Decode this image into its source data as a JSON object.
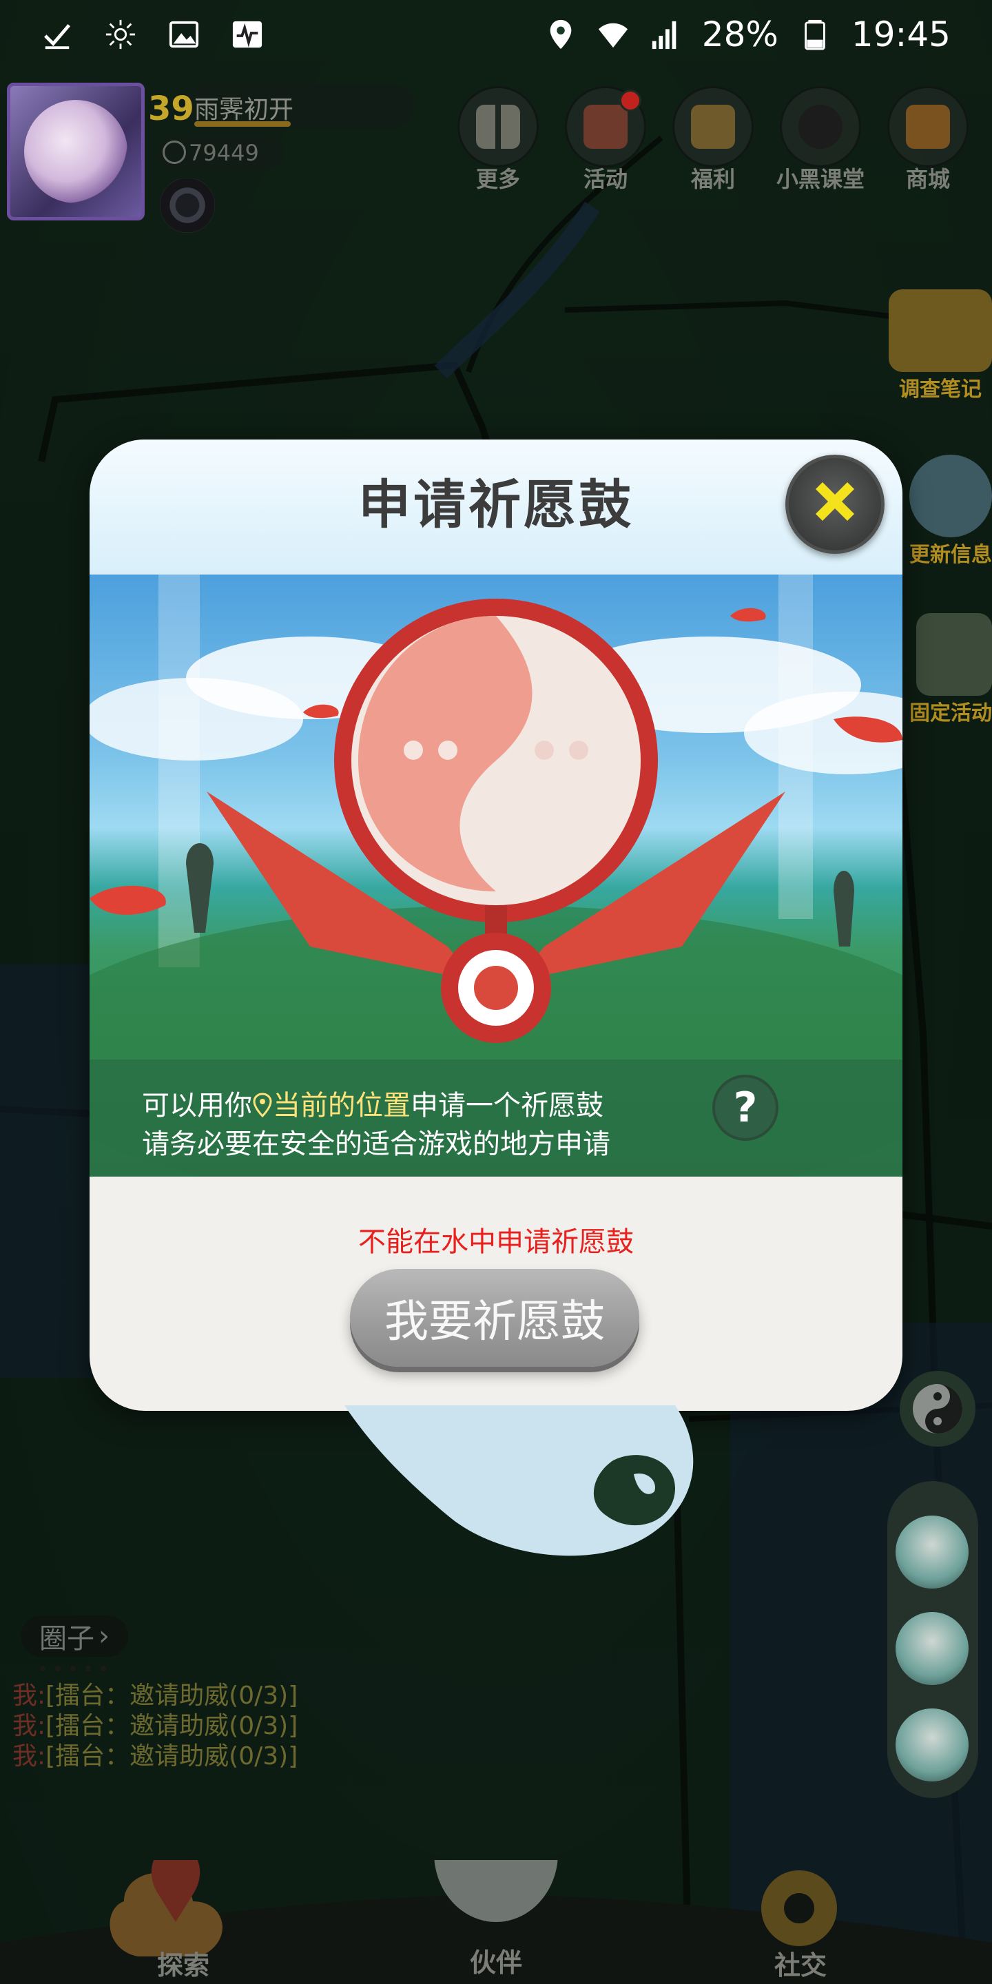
{
  "status_bar": {
    "battery": "28%",
    "time": "19:45"
  },
  "hud": {
    "level": "39",
    "player_name": "雨霁初开",
    "coins": "79449"
  },
  "top_menu": [
    {
      "label": "更多",
      "icon": "grid-icon"
    },
    {
      "label": "活动",
      "icon": "gift-icon"
    },
    {
      "label": "福利",
      "icon": "star-box-icon"
    },
    {
      "label": "小黑课堂",
      "icon": "black-cat-icon"
    },
    {
      "label": "商城",
      "icon": "shop-icon"
    }
  ],
  "side_widgets": [
    {
      "label": "调查笔记"
    },
    {
      "label": "更新信息"
    },
    {
      "label": "固定活动"
    }
  ],
  "dialog": {
    "title": "申请祈愿鼓",
    "info_line1_before": "可以用你",
    "info_line1_highlight": "当前的位置",
    "info_line1_after": "申请一个祈愿鼓",
    "info_line2": "请务必要在安全的适合游戏的地方申请",
    "help_label": "?",
    "error": "不能在水中申请祈愿鼓",
    "button": "我要祈愿鼓"
  },
  "chat": {
    "tag": "圈子",
    "lines": [
      {
        "speaker": "我:",
        "text": "[擂台：邀请助威(0/3)]"
      },
      {
        "speaker": "我:",
        "text": "[擂台：邀请助威(0/3)]"
      },
      {
        "speaker": "我:",
        "text": "[擂台：邀请助威(0/3)]"
      }
    ]
  },
  "bottom_nav": {
    "explore": "探索",
    "partner": "伙伴",
    "social": "社交"
  },
  "colors": {
    "error": "#e8201e",
    "highlight": "#ffe27a",
    "close_x": "#f4e21c"
  }
}
